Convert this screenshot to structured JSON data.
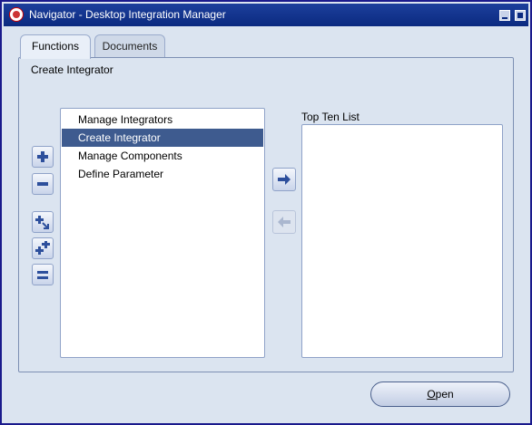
{
  "window": {
    "title": "Navigator - Desktop Integration Manager"
  },
  "tabs": [
    {
      "label": "Functions",
      "active": true
    },
    {
      "label": "Documents",
      "active": false
    }
  ],
  "panel": {
    "heading": "Create Integrator"
  },
  "functions_list": {
    "items": [
      {
        "label": "Manage Integrators",
        "selected": false
      },
      {
        "label": "Create Integrator",
        "selected": true
      },
      {
        "label": "Manage Components",
        "selected": false
      },
      {
        "label": "Define Parameter",
        "selected": false
      }
    ]
  },
  "top_ten": {
    "label": "Top Ten List",
    "items": []
  },
  "open_button": {
    "mnemonic": "O",
    "rest": "pen"
  },
  "colors": {
    "title_bar": "#0b2a80",
    "selection": "#3e5b8f",
    "background": "#dbe4f0"
  }
}
